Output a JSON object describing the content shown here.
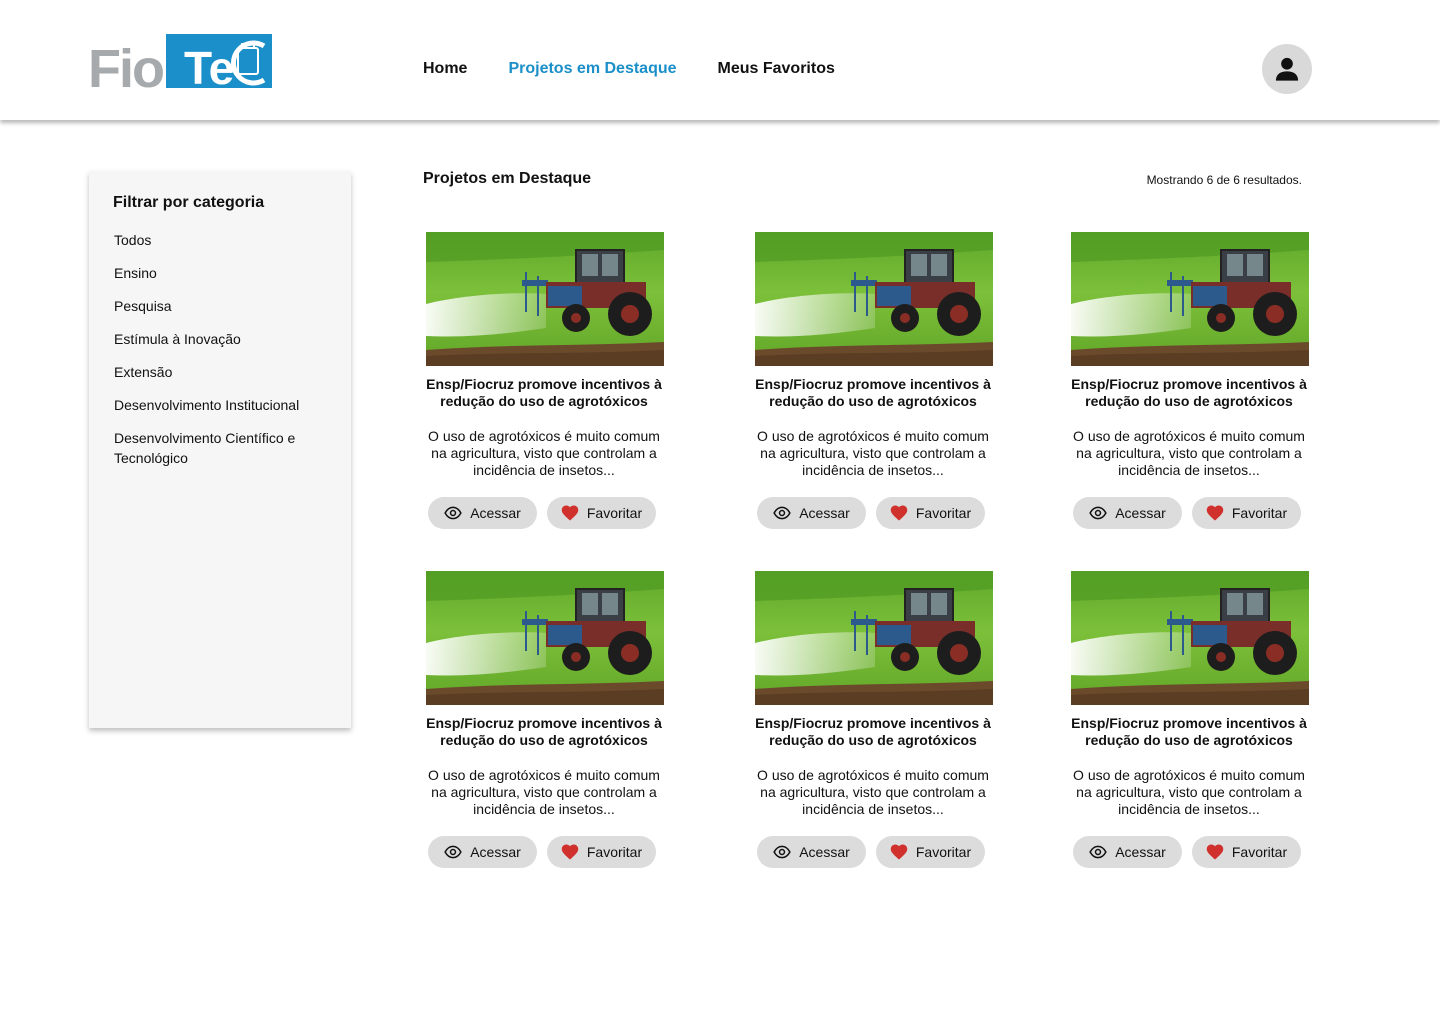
{
  "brand": {
    "logo_text": "FioTeC",
    "accent": "#1b8fc9",
    "logo_grey": "#a7aaad"
  },
  "nav": {
    "items": [
      {
        "label": "Home",
        "active": false
      },
      {
        "label": "Projetos em Destaque",
        "active": true
      },
      {
        "label": "Meus Favoritos",
        "active": false
      }
    ],
    "user_icon": "user-icon"
  },
  "sidebar": {
    "title": "Filtrar por categoria",
    "categories": [
      "Todos",
      "Ensino",
      "Pesquisa",
      "Estímula à Inovação",
      "Extensão",
      "Desenvolvimento Institucional",
      "Desenvolvimento Científico e Tecnológico"
    ]
  },
  "main": {
    "title": "Projetos em Destaque",
    "results": "Mostrando 6 de 6 resultados.",
    "cards": [
      {
        "title": "Ensp/Fiocruz promove incentivos à redução do uso de agrotóxicos",
        "description": "O uso de agrotóxicos é muito comum na agricultura, visto que controlam a incidência de insetos...",
        "access_label": "Acessar",
        "favorite_label": "Favoritar",
        "image": "tractor-spraying-field"
      },
      {
        "title": "Ensp/Fiocruz promove incentivos à redução do uso de agrotóxicos",
        "description": "O uso de agrotóxicos é muito comum na agricultura, visto que controlam a incidência de insetos...",
        "access_label": "Acessar",
        "favorite_label": "Favoritar",
        "image": "tractor-spraying-field"
      },
      {
        "title": "Ensp/Fiocruz promove incentivos à redução do uso de agrotóxicos",
        "description": "O uso de agrotóxicos é muito comum na agricultura, visto que controlam a incidência de insetos...",
        "access_label": "Acessar",
        "favorite_label": "Favoritar",
        "image": "tractor-spraying-field"
      },
      {
        "title": "Ensp/Fiocruz promove incentivos à redução do uso de agrotóxicos",
        "description": "O uso de agrotóxicos é muito comum na agricultura, visto que controlam a incidência de insetos...",
        "access_label": "Acessar",
        "favorite_label": "Favoritar",
        "image": "tractor-spraying-field"
      },
      {
        "title": "Ensp/Fiocruz promove incentivos à redução do uso de agrotóxicos",
        "description": "O uso de agrotóxicos é muito comum na agricultura, visto que controlam a incidência de insetos...",
        "access_label": "Acessar",
        "favorite_label": "Favoritar",
        "image": "tractor-spraying-field"
      },
      {
        "title": "Ensp/Fiocruz promove incentivos à redução do uso de agrotóxicos",
        "description": "O uso de agrotóxicos é muito comum na agricultura, visto que controlam a incidência de insetos...",
        "access_label": "Acessar",
        "favorite_label": "Favoritar",
        "image": "tractor-spraying-field"
      }
    ]
  }
}
